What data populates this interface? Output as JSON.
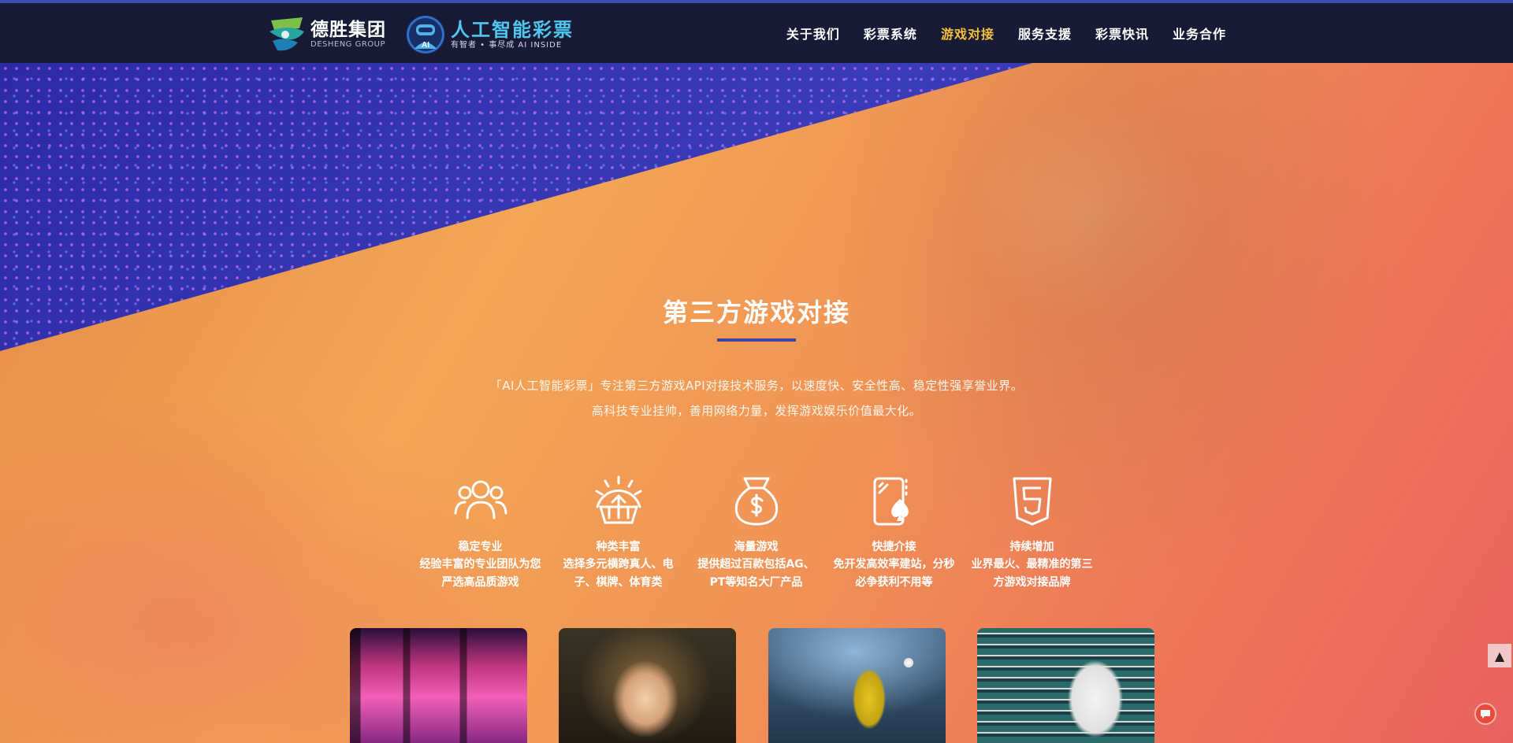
{
  "header": {
    "logo_ds": {
      "cn": "德胜集团",
      "en": "DESHENG GROUP"
    },
    "logo_ai": {
      "cn": "人工智能彩票",
      "sub": "有智者 • 事尽成  AI INSIDE",
      "badge": "AI"
    },
    "nav": [
      {
        "label": "关于我们",
        "active": false
      },
      {
        "label": "彩票系统",
        "active": false
      },
      {
        "label": "游戏对接",
        "active": true
      },
      {
        "label": "服务支援",
        "active": false
      },
      {
        "label": "彩票快讯",
        "active": false
      },
      {
        "label": "业务合作",
        "active": false
      }
    ]
  },
  "hero": {
    "title": "第三方游戏对接",
    "intro_line1": "「AI人工智能彩票」专注第三方游戏API对接技术服务，以速度快、安全性高、稳定性强享誉业界。",
    "intro_line2": "高科技专业挂帅，善用网络力量，发挥游戏娱乐价值最大化。"
  },
  "features": [
    {
      "icon": "team-icon",
      "title": "稳定专业",
      "desc": [
        "经验丰富的专业团队为您",
        "严选高品质游戏"
      ]
    },
    {
      "icon": "gear-growth-icon",
      "title": "种类丰富",
      "desc": [
        "选择多元横跨真人、电",
        "子、棋牌、体育类"
      ]
    },
    {
      "icon": "money-bag-icon",
      "title": "海量游戏",
      "desc": [
        "提供超过百款包括AG、",
        "PT等知名大厂产品"
      ]
    },
    {
      "icon": "mobile-spade-icon",
      "title": "快捷介接",
      "desc": [
        "免开发高效率建站，分秒",
        "必争获利不用等"
      ]
    },
    {
      "icon": "html5-icon",
      "title": "持续增加",
      "desc": [
        "业界最火、最精准的第三",
        "方游戏对接品牌"
      ]
    }
  ],
  "cards": [
    {
      "name": "slot-machine-card"
    },
    {
      "name": "live-casino-card"
    },
    {
      "name": "sports-card"
    },
    {
      "name": "poker-card"
    }
  ],
  "widgets": {
    "scroll_top": "▲"
  },
  "colors": {
    "accent": "#f3c13a",
    "header_bg": "#181a36",
    "title_bar": "#3b47a0"
  }
}
